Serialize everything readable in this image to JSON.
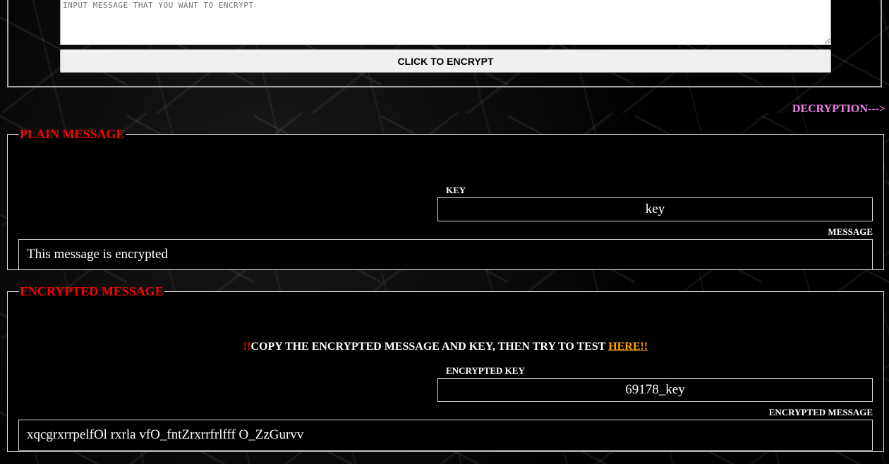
{
  "encrypt_form": {
    "input_placeholder": "INPUT MESSAGE THAT YOU WANT TO ENCRYPT",
    "input_value": "",
    "button_label": "CLICK TO ENCRYPT"
  },
  "decryption_link": "DECRYPTION--->",
  "plain_panel": {
    "legend": "PLAIN MESSAGE",
    "key_label": "KEY",
    "key_value": "key",
    "message_label": "MESSAGE",
    "message_value": "This message is encrypted"
  },
  "encrypted_panel": {
    "legend": "ENCRYPTED MESSAGE",
    "notice_prefix": "!!",
    "notice_text": "COPY THE ENCRYPTED MESSAGE AND KEY, THEN TRY TO TEST ",
    "notice_link": "HERE!!",
    "key_label": "ENCRYPTED KEY",
    "key_value": "69178_key",
    "message_label": "ENCRYPTED MESSAGE",
    "message_value": "xqcgrxrrpelfOl rxrla vfO_fntZrxrrfrlfff O_ZzGurvv"
  },
  "colors": {
    "legend": "#ff0000",
    "decryption_link": "#ee82ee",
    "here_link": "#ffa500"
  }
}
